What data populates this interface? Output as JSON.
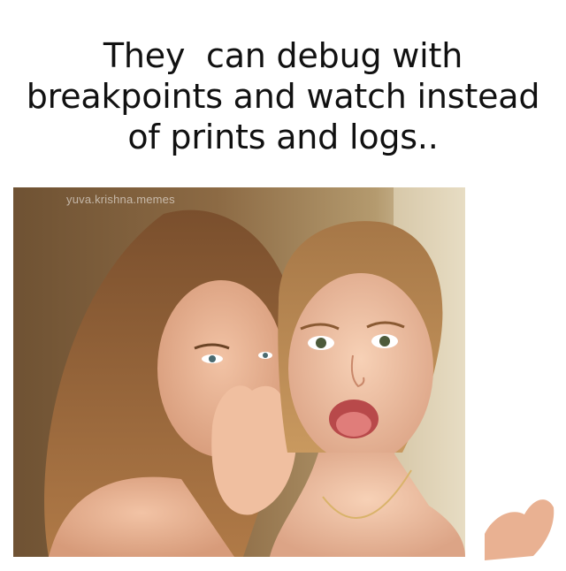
{
  "caption": {
    "line1": "They  can debug with",
    "line2": "breakpoints and watch instead",
    "line3": "of prints and logs.."
  },
  "photo": {
    "watermark": "yuva.krishna.memes",
    "description_icon": "whispering-girls-photo"
  }
}
